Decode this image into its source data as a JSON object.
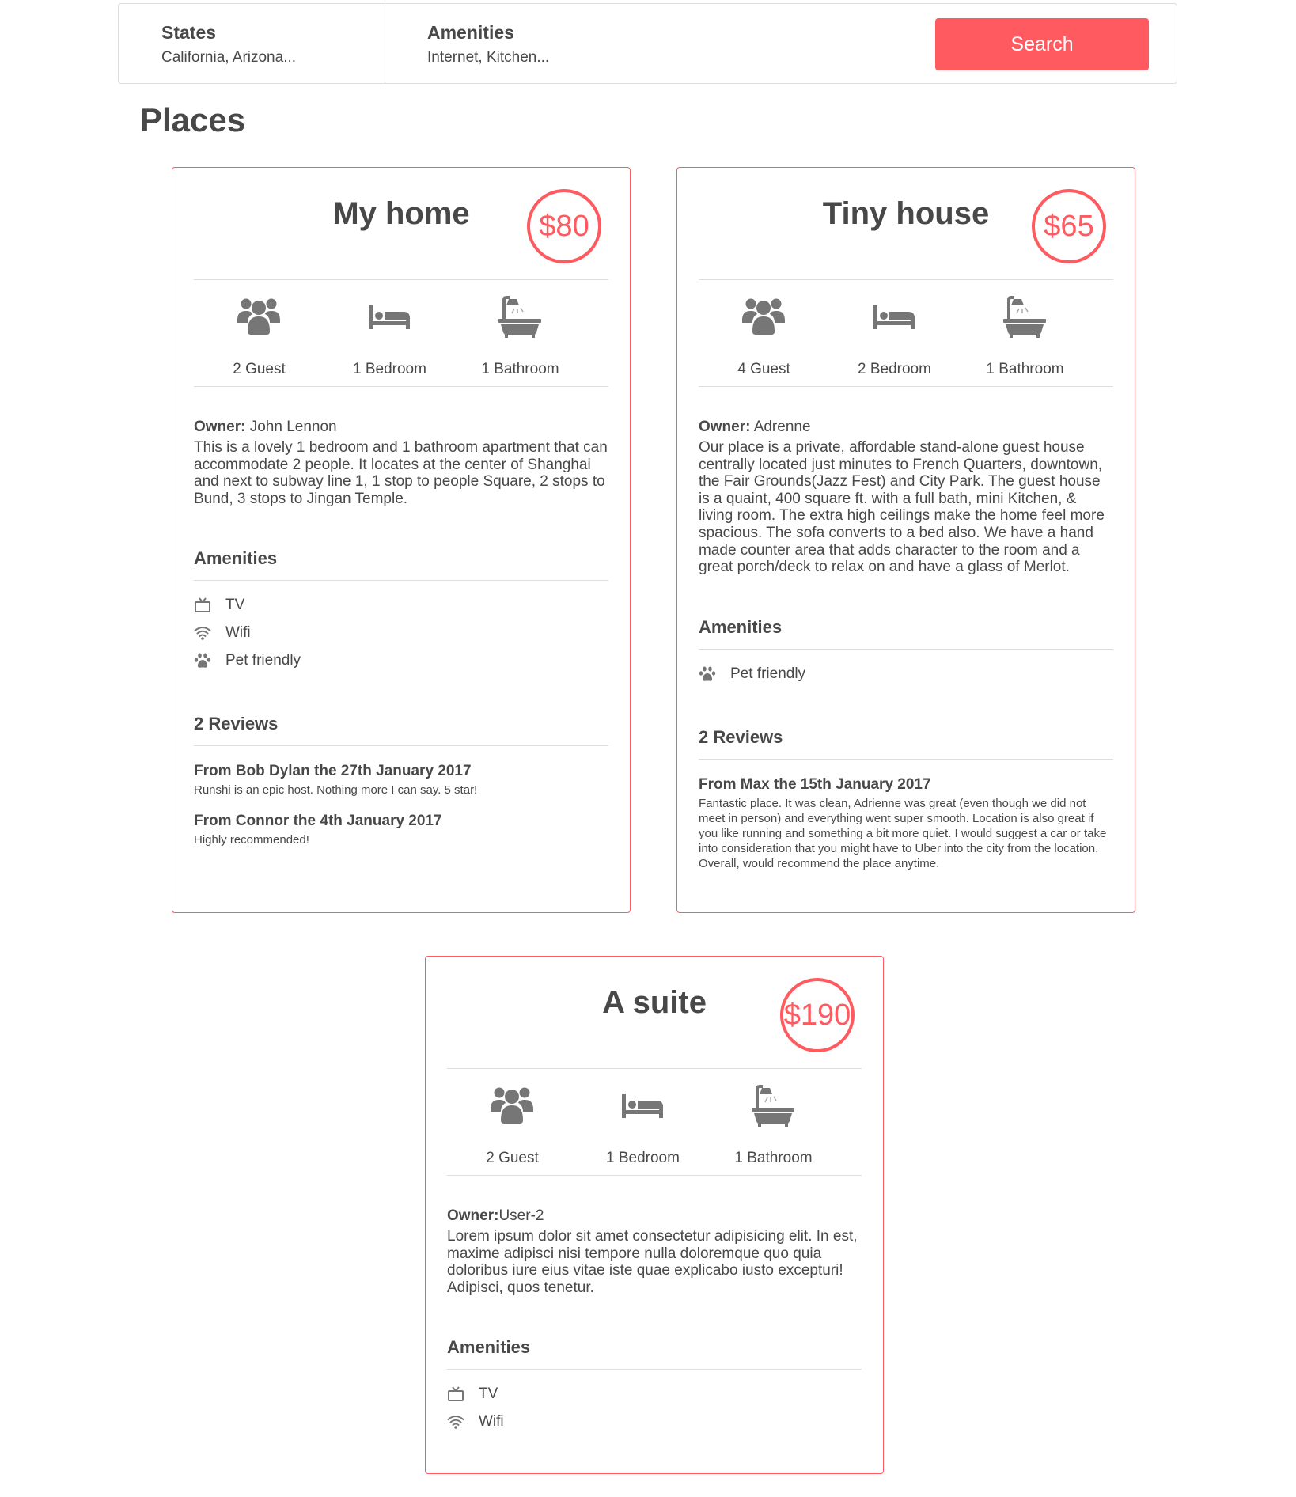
{
  "filters": {
    "states": {
      "title": "States",
      "value": "California, Arizona..."
    },
    "amenities": {
      "title": "Amenities",
      "value": "Internet, Kitchen..."
    },
    "search_label": "Search"
  },
  "places_title": "Places",
  "colors": {
    "accent": "#ff5a5f",
    "text": "#484848",
    "border": "#dddddd",
    "icon": "#767676"
  },
  "places": [
    {
      "name": "My home",
      "price": "$80",
      "guests": "2 Guest",
      "bedrooms": "1 Bedroom",
      "bathrooms": "1 Bathroom",
      "owner_label": "Owner:",
      "owner": "John Lennon",
      "description": "This is a lovely 1 bedroom and 1 bathroom apartment that can accommodate 2 people. It locates at the center of Shanghai and next to subway line 1, 1 stop to people Square, 2 stops to Bund, 3 stops to Jingan Temple.",
      "amenities_title": "Amenities",
      "amenities": [
        {
          "icon": "tv-icon",
          "label": "TV"
        },
        {
          "icon": "wifi-icon",
          "label": "Wifi"
        },
        {
          "icon": "paw-icon",
          "label": "Pet friendly"
        }
      ],
      "reviews_title": "2 Reviews",
      "reviews": [
        {
          "header": "From Bob Dylan the 27th January 2017",
          "text": "Runshi is an epic host. Nothing more I can say. 5 star!"
        },
        {
          "header": "From Connor the 4th January 2017",
          "text": "Highly recommended!"
        }
      ]
    },
    {
      "name": "Tiny house",
      "price": "$65",
      "guests": "4 Guest",
      "bedrooms": "2 Bedroom",
      "bathrooms": "1 Bathroom",
      "owner_label": "Owner:",
      "owner": "Adrenne",
      "description": "Our place is a private, affordable stand-alone guest house centrally located just minutes to French Quarters, downtown, the Fair Grounds(Jazz Fest) and City Park. The guest house is a quaint, 400 square ft. with a full bath, mini Kitchen, & living room. The extra high ceilings make the home feel more spacious. The sofa converts to a bed also. We have a hand made counter area that adds character to the room and a great porch/deck to relax on and have a glass of Merlot.",
      "amenities_title": "Amenities",
      "amenities": [
        {
          "icon": "paw-icon",
          "label": "Pet friendly"
        }
      ],
      "reviews_title": "2 Reviews",
      "reviews": [
        {
          "header": "From Max the 15th January 2017",
          "text": "Fantastic place. It was clean, Adrienne was great (even though we did not meet in person) and everything went super smooth. Location is also great if you like running and something a bit more quiet. I would suggest a car or take into consideration that you might have to Uber into the city from the location. Overall, would recommend the place anytime."
        }
      ]
    },
    {
      "name": "A suite",
      "price": "$190",
      "guests": "2 Guest",
      "bedrooms": "1 Bedroom",
      "bathrooms": "1 Bathroom",
      "owner_label": "Owner:",
      "owner": "User-2",
      "description": "Lorem ipsum dolor sit amet consectetur adipisicing elit. In est, maxime adipisci nisi tempore nulla doloremque quo quia doloribus iure eius vitae iste quae explicabo iusto excepturi! Adipisci, quos tenetur.",
      "amenities_title": "Amenities",
      "amenities": [
        {
          "icon": "tv-icon",
          "label": "TV"
        },
        {
          "icon": "wifi-icon",
          "label": "Wifi"
        }
      ]
    }
  ]
}
